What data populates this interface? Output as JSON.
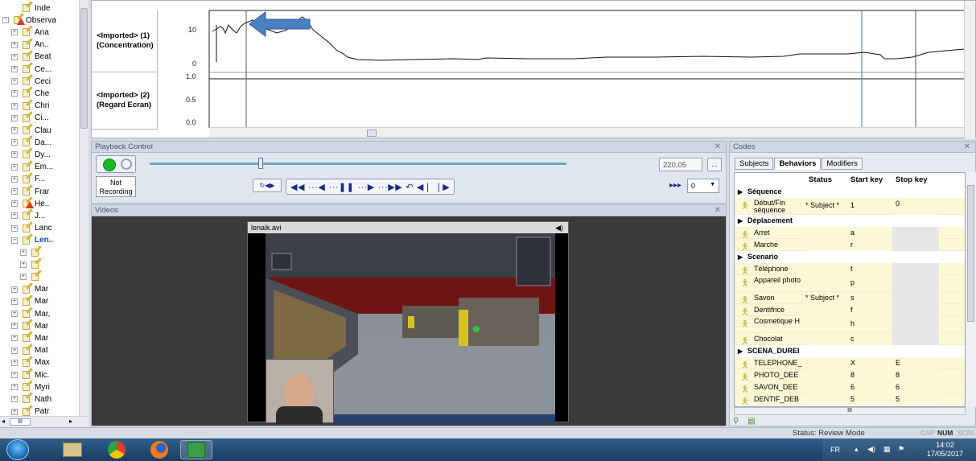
{
  "tree": {
    "items": [
      {
        "label": "Inde",
        "icon": "index-icon",
        "indent": 1,
        "exp": ""
      },
      {
        "label": "Observa",
        "icon": "observations-warning-icon",
        "indent": 0,
        "exp": "−"
      },
      {
        "label": "Ana",
        "icon": "observation-icon",
        "indent": 1,
        "exp": "+"
      },
      {
        "label": "An..",
        "icon": "observation-icon",
        "indent": 1,
        "exp": "+"
      },
      {
        "label": "Beat",
        "icon": "observation-icon",
        "indent": 1,
        "exp": "+"
      },
      {
        "label": "Ce...",
        "icon": "observation-icon",
        "indent": 1,
        "exp": "+"
      },
      {
        "label": "Ceci",
        "icon": "observation-icon",
        "indent": 1,
        "exp": "+"
      },
      {
        "label": "Che",
        "icon": "observation-icon",
        "indent": 1,
        "exp": "+"
      },
      {
        "label": "Chri",
        "icon": "observation-icon",
        "indent": 1,
        "exp": "+"
      },
      {
        "label": "Ci...",
        "icon": "observation-icon",
        "indent": 1,
        "exp": "+"
      },
      {
        "label": "Clau",
        "icon": "observation-icon",
        "indent": 1,
        "exp": "+"
      },
      {
        "label": "Da...",
        "icon": "observation-icon",
        "indent": 1,
        "exp": "+"
      },
      {
        "label": "Dy...",
        "icon": "observation-icon",
        "indent": 1,
        "exp": "+"
      },
      {
        "label": "Em...",
        "icon": "observation-icon",
        "indent": 1,
        "exp": "+"
      },
      {
        "label": "F...",
        "icon": "observation-icon",
        "indent": 1,
        "exp": "+"
      },
      {
        "label": "Frar",
        "icon": "observation-icon",
        "indent": 1,
        "exp": "+"
      },
      {
        "label": "He..",
        "icon": "observation-warning-icon",
        "indent": 1,
        "exp": "+"
      },
      {
        "label": "J...",
        "icon": "observation-icon",
        "indent": 1,
        "exp": "+"
      },
      {
        "label": "Lanc",
        "icon": "observation-icon",
        "indent": 1,
        "exp": "+"
      },
      {
        "label": "Len..",
        "icon": "observation-icon",
        "indent": 1,
        "exp": "−",
        "selected": true
      },
      {
        "label": "",
        "icon": "folder-icon",
        "indent": 2,
        "exp": "+"
      },
      {
        "label": "",
        "icon": "media-icon",
        "indent": 2,
        "exp": "+"
      },
      {
        "label": "",
        "icon": "data-icon",
        "indent": 2,
        "exp": "+"
      },
      {
        "label": "Mar",
        "icon": "observation-icon",
        "indent": 1,
        "exp": "+"
      },
      {
        "label": "Mar",
        "icon": "observation-icon",
        "indent": 1,
        "exp": "+"
      },
      {
        "label": "Mar,",
        "icon": "observation-icon",
        "indent": 1,
        "exp": "+"
      },
      {
        "label": "Mar",
        "icon": "observation-icon",
        "indent": 1,
        "exp": "+"
      },
      {
        "label": "Mar",
        "icon": "observation-icon",
        "indent": 1,
        "exp": "+"
      },
      {
        "label": "Mat",
        "icon": "observation-icon",
        "indent": 1,
        "exp": "+"
      },
      {
        "label": "Max",
        "icon": "observation-icon",
        "indent": 1,
        "exp": "+"
      },
      {
        "label": "Mic.",
        "icon": "observation-icon",
        "indent": 1,
        "exp": "+"
      },
      {
        "label": "Myri",
        "icon": "observation-icon",
        "indent": 1,
        "exp": "+"
      },
      {
        "label": "Nath",
        "icon": "observation-icon",
        "indent": 1,
        "exp": "+"
      },
      {
        "label": "Patr",
        "icon": "observation-icon",
        "indent": 1,
        "exp": "+"
      }
    ],
    "hscroll_label": "III"
  },
  "graph": {
    "tracks": [
      {
        "label": "<Imported> (1) (Concentration)",
        "ticks": [
          "10",
          "0"
        ]
      },
      {
        "label": "<Imported> (2) (Regard Ecran)",
        "ticks": [
          "1.0",
          "0.5",
          "0.0"
        ]
      }
    ]
  },
  "playback": {
    "title": "Playback Control",
    "recording_status": "Not Recording",
    "time_value": "220,05",
    "browse_label": "...",
    "rate_value": "0",
    "slider_position": 0.26
  },
  "videos": {
    "title": "Videos",
    "file_name": "lenaik.avi"
  },
  "codes": {
    "title": "Codes",
    "tabs": [
      "Subjects",
      "Behaviors",
      "Modifiers"
    ],
    "active_tab": "Behaviors",
    "columns": {
      "status": "Status",
      "start": "Start key",
      "stop": "Stop key"
    },
    "rows": [
      {
        "type": "cat",
        "name": "Séquence"
      },
      {
        "type": "beh",
        "name": "Début/Fin séquence",
        "status": "* Subject *",
        "start": "1",
        "stop": "0",
        "stop_bg": "yel"
      },
      {
        "type": "cat",
        "name": "Déplacement"
      },
      {
        "type": "beh",
        "name": "Arret",
        "status": "",
        "start": "a",
        "stop": "",
        "stop_bg": "grey"
      },
      {
        "type": "beh",
        "name": "Marche",
        "status": "",
        "start": "r",
        "stop": "",
        "stop_bg": "grey"
      },
      {
        "type": "cat",
        "name": "Scenario"
      },
      {
        "type": "beh",
        "name": "Téléphone",
        "status": "",
        "start": "t",
        "stop": "",
        "stop_bg": "grey"
      },
      {
        "type": "beh",
        "name": "Appareil photo",
        "status": "",
        "start": "p",
        "stop": "",
        "stop_bg": "grey"
      },
      {
        "type": "beh",
        "name": "Savon",
        "status": "* Subject *",
        "start": "s",
        "stop": "",
        "stop_bg": "grey"
      },
      {
        "type": "beh",
        "name": "Dentifrice",
        "status": "",
        "start": "f",
        "stop": "",
        "stop_bg": "grey"
      },
      {
        "type": "beh",
        "name": "Cosmetique H",
        "status": "",
        "start": "h",
        "stop": "",
        "stop_bg": "grey"
      },
      {
        "type": "beh",
        "name": "Chocolat",
        "status": "",
        "start": "c",
        "stop": "",
        "stop_bg": "grey"
      },
      {
        "type": "cat",
        "name": "SCENA_DUREI"
      },
      {
        "type": "beh",
        "name": "TELEPHONE_",
        "status": "",
        "start": "X",
        "stop": "E",
        "stop_bg": "yel"
      },
      {
        "type": "beh",
        "name": "PHOTO_DEE",
        "status": "",
        "start": "8",
        "stop": "8",
        "stop_bg": "yel"
      },
      {
        "type": "beh",
        "name": "SAVON_DEE",
        "status": "",
        "start": "6",
        "stop": "6",
        "stop_bg": "yel"
      },
      {
        "type": "beh",
        "name": "DENTIF_DEB",
        "status": "",
        "start": "5",
        "stop": "5",
        "stop_bg": "yel"
      }
    ],
    "hscroll_label": "III"
  },
  "statusbar": {
    "status": "Status: Review Mode",
    "caps": "CAP",
    "num": "NUM",
    "scroll": "SCRL"
  },
  "taskbar": {
    "language": "FR",
    "time": "14:02",
    "date": "17/05/2017"
  },
  "colors": {
    "accent_blue": "#4a7fc1",
    "record_green": "#1bb626",
    "behavior_yellow": "#fbf8d6"
  }
}
